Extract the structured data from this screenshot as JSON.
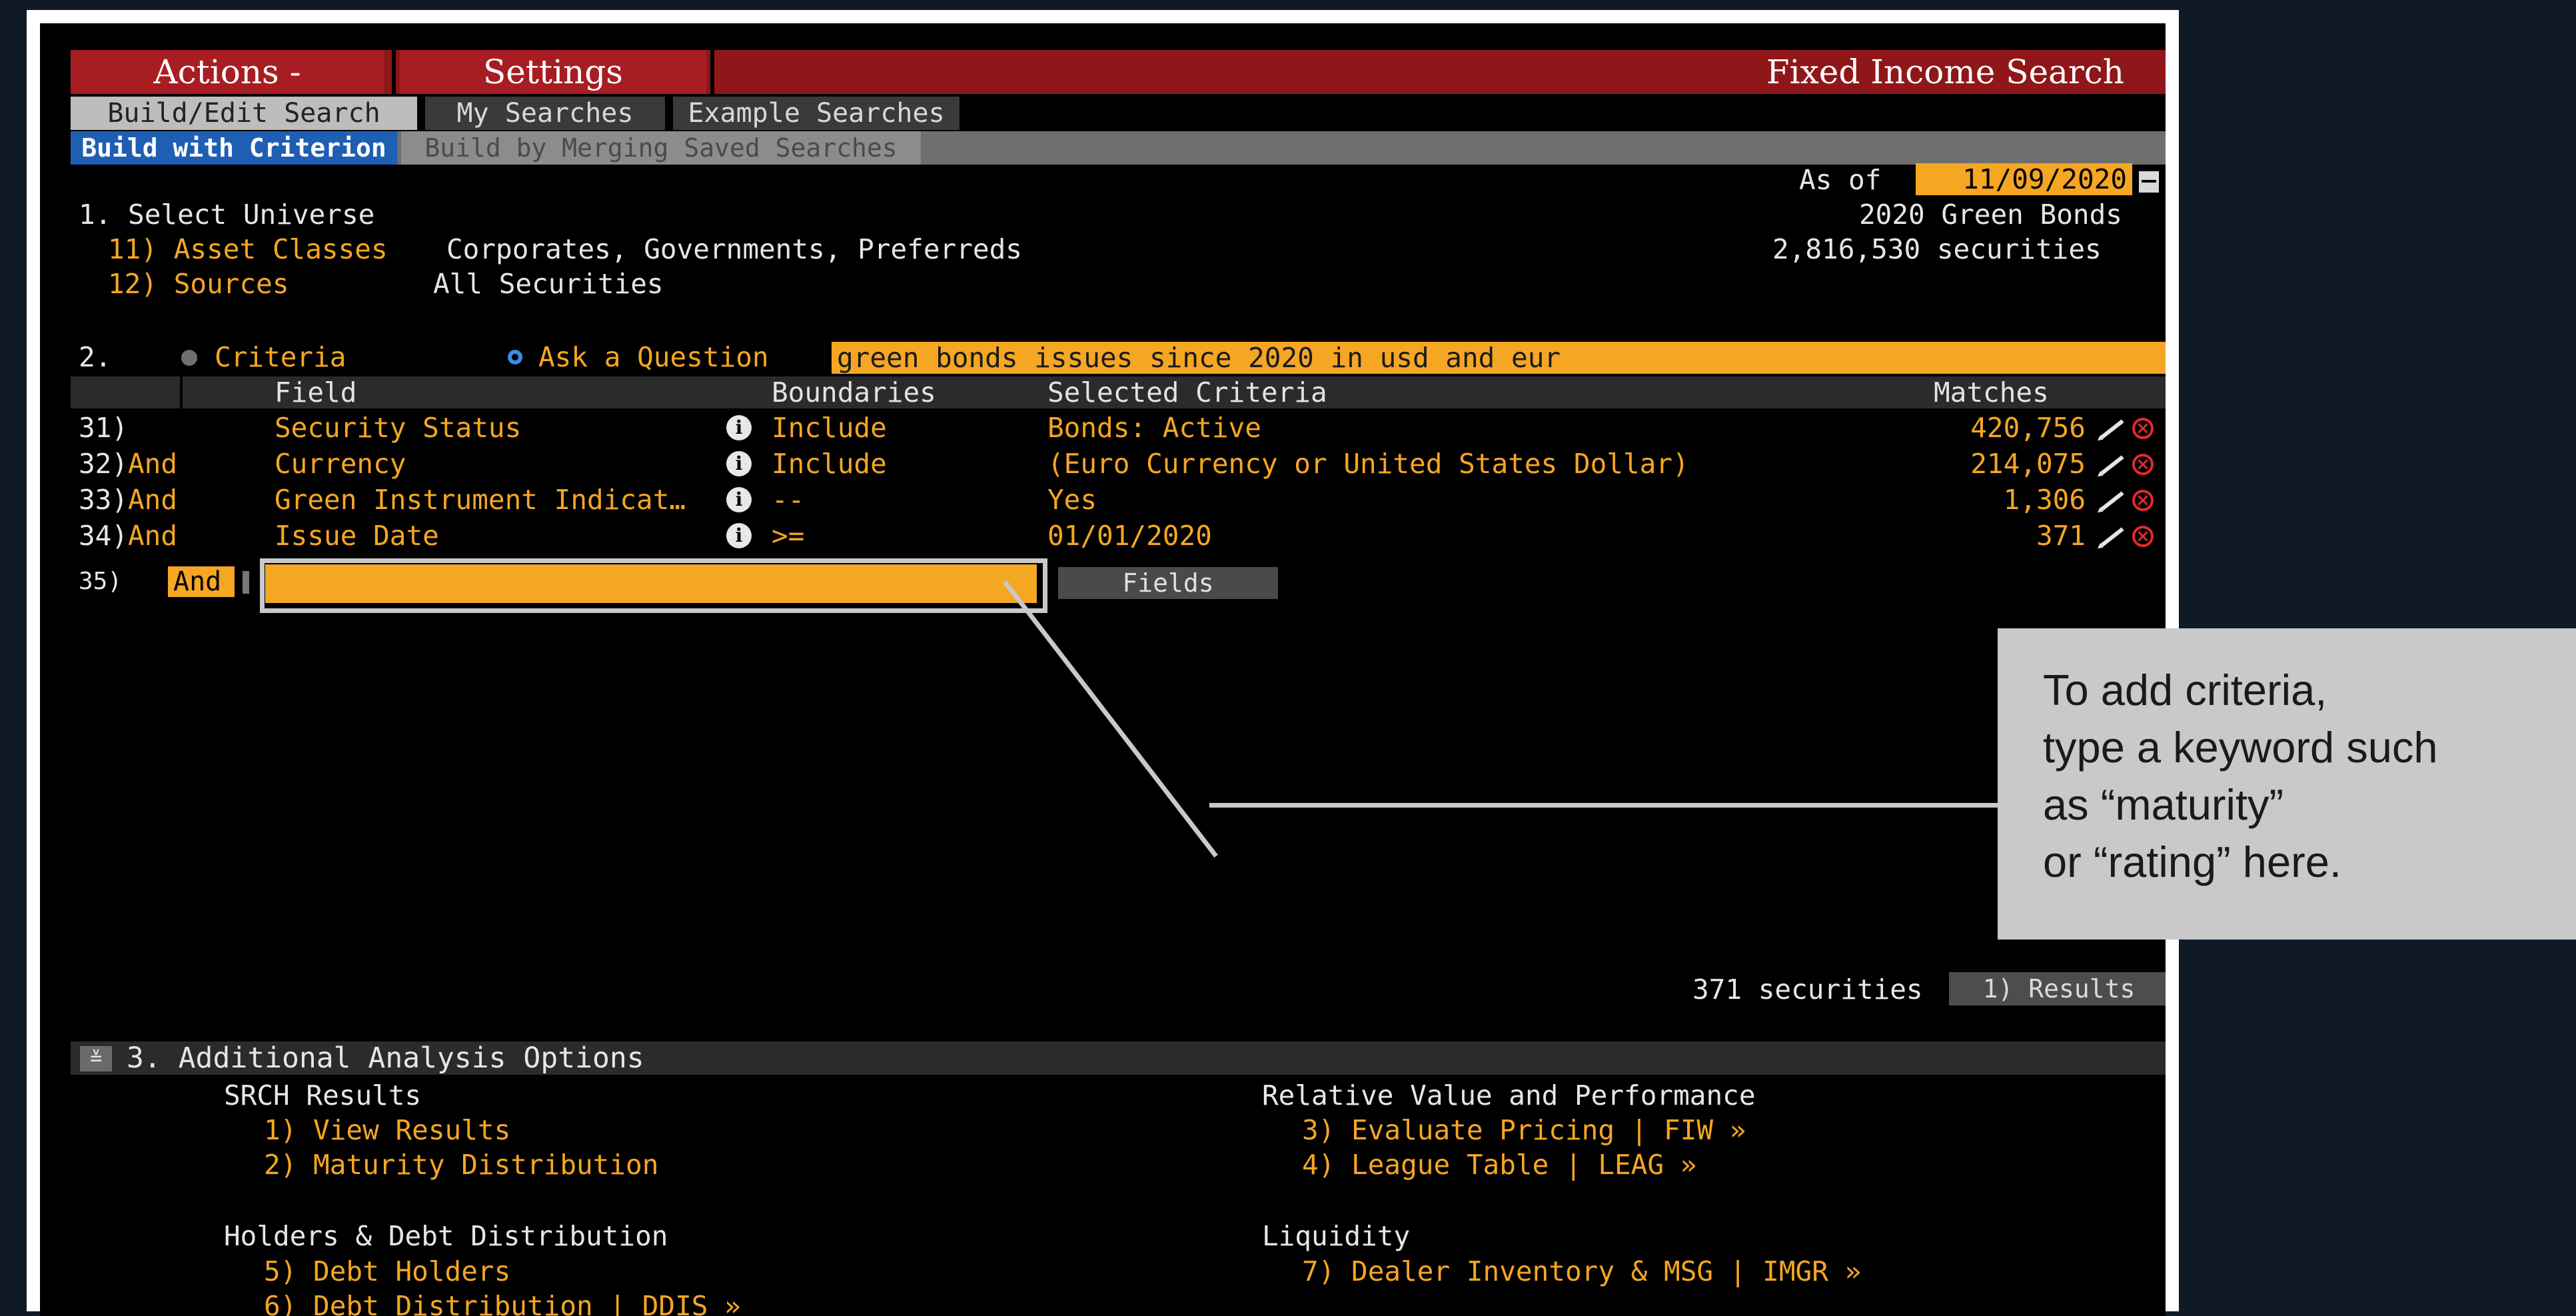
{
  "menu": {
    "actions": "Actions -",
    "settings": "Settings",
    "title": "Fixed Income Search"
  },
  "tabs": [
    "Build/Edit Search",
    "My Searches",
    "Example Searches"
  ],
  "subtabs": [
    "Build with Criterion",
    "Build by Merging Saved Searches"
  ],
  "asof": {
    "label": "As of",
    "date": "11/09/2020"
  },
  "section1": {
    "title": "1. Select Universe",
    "asset_classes_label": "11) Asset Classes",
    "asset_classes_value": "Corporates, Governments, Preferreds",
    "sources_label": "12) Sources",
    "sources_value": "All Securities",
    "search_name": "2020 Green Bonds",
    "security_count": "2,816,530 securities"
  },
  "section2": {
    "num": "2.",
    "criteria": "Criteria",
    "ask": "Ask a Question",
    "query": "green bonds issues since 2020 in usd and eur",
    "headers": {
      "field": "Field",
      "boundaries": "Boundaries",
      "selected": "Selected Criteria",
      "matches": "Matches"
    },
    "rows": [
      {
        "num": "31)",
        "and": "",
        "field": "Security Status",
        "boundary": "Include",
        "criteria": "Bonds: Active",
        "matches": "420,756"
      },
      {
        "num": "32)",
        "and": "And",
        "field": "Currency",
        "boundary": "Include",
        "criteria": "(Euro Currency or United States Dollar)",
        "matches": "214,075"
      },
      {
        "num": "33)",
        "and": "And",
        "field": "Green Instrument Indicat…",
        "boundary": "--",
        "criteria": "Yes",
        "matches": "1,306"
      },
      {
        "num": "34)",
        "and": "And",
        "field": "Issue Date",
        "boundary": ">=",
        "criteria": "01/01/2020",
        "matches": "371"
      }
    ],
    "new_row": {
      "num": "35)",
      "and": "And",
      "fields_button": "Fields"
    }
  },
  "callout": {
    "lines": [
      "To add criteria,",
      "type a keyword such",
      "as “maturity”",
      "or “rating” here."
    ]
  },
  "results": {
    "count": "371 securities",
    "button": "1) Results"
  },
  "section3": {
    "title": "3. Additional Analysis Options",
    "srch_heading": "SRCH Results",
    "view_results": "1) View Results",
    "maturity": "2) Maturity Distribution",
    "rv_heading": "Relative Value and Performance",
    "eval": "3) Evaluate Pricing | FIW »",
    "league": "4) League Table | LEAG »",
    "holders_heading": "Holders & Debt Distribution",
    "debt_holders": "5) Debt Holders",
    "debt_dist": "6) Debt Distribution | DDIS »",
    "liq_heading": "Liquidity",
    "dealer": "7) Dealer Inventory & MSG | IMGR »"
  },
  "colors": {
    "accent_orange": "#f5a623",
    "menu_red": "#a81d22",
    "callout_gray": "#c9c9c9"
  }
}
